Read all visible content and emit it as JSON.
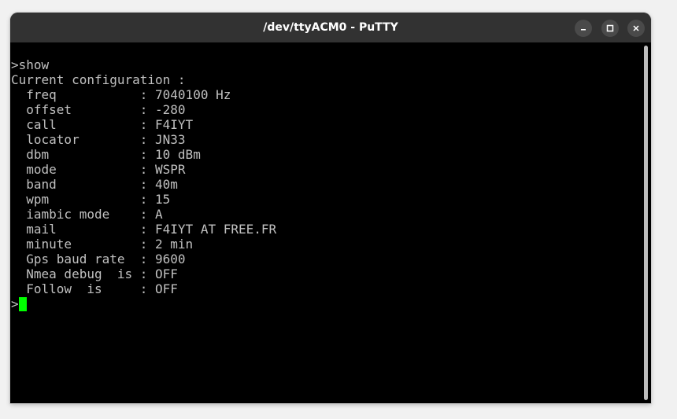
{
  "window": {
    "title": "/dev/ttyACM0 - PuTTY"
  },
  "controls": {
    "minimize_icon": "minimize-icon",
    "maximize_icon": "maximize-icon",
    "close_icon": "close-icon"
  },
  "terminal": {
    "lines": [
      ">show",
      "Current configuration :",
      "  freq           : 7040100 Hz",
      "  offset         : -280",
      "  call           : F4IYT",
      "  locator        : JN33",
      "  dbm            : 10 dBm",
      "  mode           : WSPR",
      "  band           : 40m",
      "  wpm            : 15",
      "  iambic mode    : A",
      "  mail           : F4IYT AT FREE.FR",
      "  minute         : 2 min",
      "  Gps baud rate  : 9600",
      "  Nmea debug  is : OFF",
      "  Follow  is     : OFF"
    ],
    "prompt": ">",
    "text_color": "#c0c0c0",
    "background_color": "#000000",
    "cursor_color": "#00ff00"
  }
}
